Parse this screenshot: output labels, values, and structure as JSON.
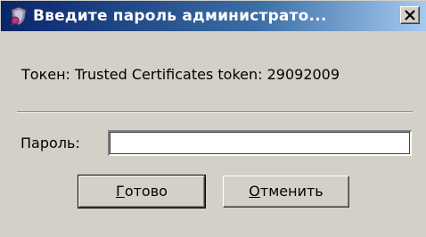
{
  "window": {
    "title": "Введите пароль администрато...",
    "title_icon": "certificate-shield-icon",
    "close_icon": "close-icon"
  },
  "content": {
    "token_label": "Токен: Trusted Certificates token: 29092009",
    "password_label": "Пароль:",
    "password_value": "",
    "password_placeholder": ""
  },
  "buttons": {
    "ok_mnemonic": "Г",
    "ok_rest": "отово",
    "cancel_mnemonic": "О",
    "cancel_rest": "тменить"
  },
  "colors": {
    "dialog_bg": "#d4d0c8",
    "titlebar_start": "#0a246a",
    "titlebar_end": "#a6caf0"
  }
}
